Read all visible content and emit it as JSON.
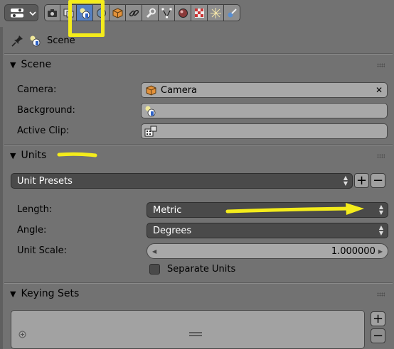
{
  "context": {
    "label": "Scene"
  },
  "panels": {
    "scene": {
      "title": "Scene",
      "camera_label": "Camera:",
      "camera_value": "Camera",
      "background_label": "Background:",
      "active_clip_label": "Active Clip:"
    },
    "units": {
      "title": "Units",
      "presets_label": "Unit Presets",
      "length_label": "Length:",
      "length_value": "Metric",
      "angle_label": "Angle:",
      "angle_value": "Degrees",
      "unit_scale_label": "Unit Scale:",
      "unit_scale_value": "1.000000",
      "separate_units_label": "Separate Units"
    },
    "keying_sets": {
      "title": "Keying Sets"
    }
  },
  "symbols": {
    "plus": "+",
    "minus": "−",
    "collapse": "▼",
    "clear": "✕",
    "up": "▲",
    "down": "▼",
    "left": "◀",
    "right": "▶"
  },
  "colors": {
    "active_tab": "#5680c2",
    "annotation_yellow": "#f4ec1b",
    "panel_bg": "#727272"
  }
}
